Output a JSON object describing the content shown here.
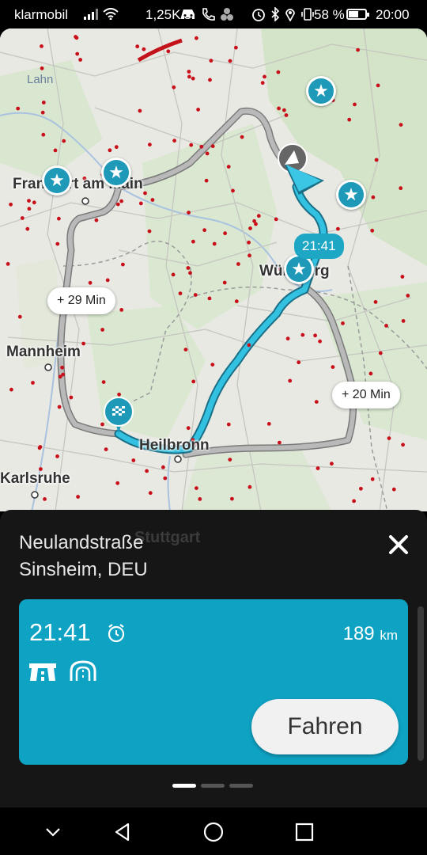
{
  "status_bar": {
    "carrier": "klarmobil",
    "net_speed": "1,25K/s",
    "battery_percent": "58 %",
    "battery_level": 0.58,
    "time": "20:00",
    "icons": [
      "signal-icon",
      "wifi-icon",
      "car-icon",
      "phone-icon",
      "apps-icon",
      "alarm-icon",
      "bluetooth-icon",
      "location-icon",
      "vibrate-icon",
      "battery-icon"
    ]
  },
  "map": {
    "cities": {
      "frankfurt": "Frankfurt am Main",
      "wuerzburg": "Würzburg",
      "mannheim": "Mannheim",
      "heilbronn": "Heilbronn",
      "karlsruhe": "Karlsruhe",
      "stuttgart": "Stuttgart"
    },
    "river": "Lahn",
    "alt_route_1_delay": "+ 29 Min",
    "alt_route_2_delay": "+ 20 Min",
    "arrival_bubble": "21:41",
    "route_color": "#1ea7c4",
    "alt_route_color": "#8a8a8a"
  },
  "destination": {
    "street": "Neulandstraße",
    "city": "Sinsheim, DEU"
  },
  "route_card": {
    "arrival_time": "21:41",
    "distance": "189",
    "distance_unit": "km",
    "feature_icons": [
      "motorway-icon",
      "tunnel-icon"
    ],
    "drive_label": "Fahren",
    "card_color": "#0ea2c3"
  },
  "pager": {
    "count": 3,
    "active": 1
  },
  "nav_bar": {
    "icons": [
      "hide-keyboard-icon",
      "back-icon",
      "home-icon",
      "recents-icon"
    ]
  }
}
